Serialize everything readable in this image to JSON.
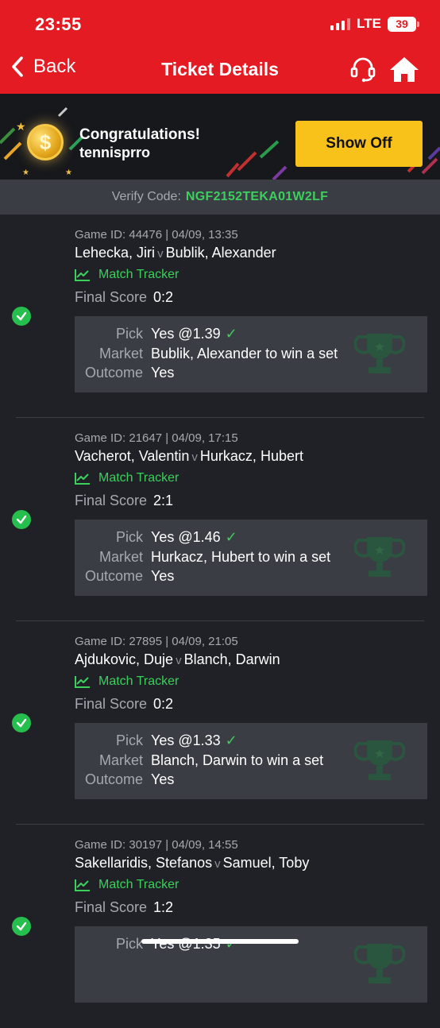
{
  "status": {
    "time": "23:55",
    "network": "LTE",
    "battery": "39"
  },
  "nav": {
    "back_label": "Back",
    "title": "Ticket Details",
    "support_icon": "headset-icon",
    "home_icon": "home-icon"
  },
  "banner": {
    "congrats": "Congratulations!",
    "username": "tennisprro",
    "button": "Show Off"
  },
  "verify": {
    "label": "Verify Code:",
    "code": "NGF2152TEKA01W2LF"
  },
  "labels": {
    "tracker": "Match Tracker",
    "final_score": "Final Score",
    "pick": "Pick",
    "market": "Market",
    "outcome": "Outcome"
  },
  "colors": {
    "brand_red": "#e41b23",
    "accent_green": "#3ccf5e",
    "button_yellow": "#f8c21a",
    "background": "#1f2126",
    "card": "#3a3d44"
  },
  "tickets": [
    {
      "game_id": "Game ID: 44476 | 04/09, 13:35",
      "home": "Lehecka, Jiri",
      "vs": "v",
      "away": "Bublik, Alexander",
      "score": "0:2",
      "pick": "Yes @1.39",
      "market": "Bublik, Alexander to win a set",
      "outcome": "Yes"
    },
    {
      "game_id": "Game ID: 21647 | 04/09, 17:15",
      "home": "Vacherot, Valentin",
      "vs": "v",
      "away": "Hurkacz, Hubert",
      "score": "2:1",
      "pick": "Yes @1.46",
      "market": "Hurkacz, Hubert to win a set",
      "outcome": "Yes"
    },
    {
      "game_id": "Game ID: 27895 | 04/09, 21:05",
      "home": "Ajdukovic, Duje",
      "vs": "v",
      "away": "Blanch, Darwin",
      "score": "0:2",
      "pick": "Yes @1.33",
      "market": "Blanch, Darwin to win a set",
      "outcome": "Yes"
    },
    {
      "game_id": "Game ID: 30197 | 04/09, 14:55",
      "home": "Sakellaridis, Stefanos",
      "vs": "v",
      "away": "Samuel, Toby",
      "score": "1:2",
      "pick": "Yes @1.35",
      "market": "",
      "outcome": ""
    }
  ]
}
